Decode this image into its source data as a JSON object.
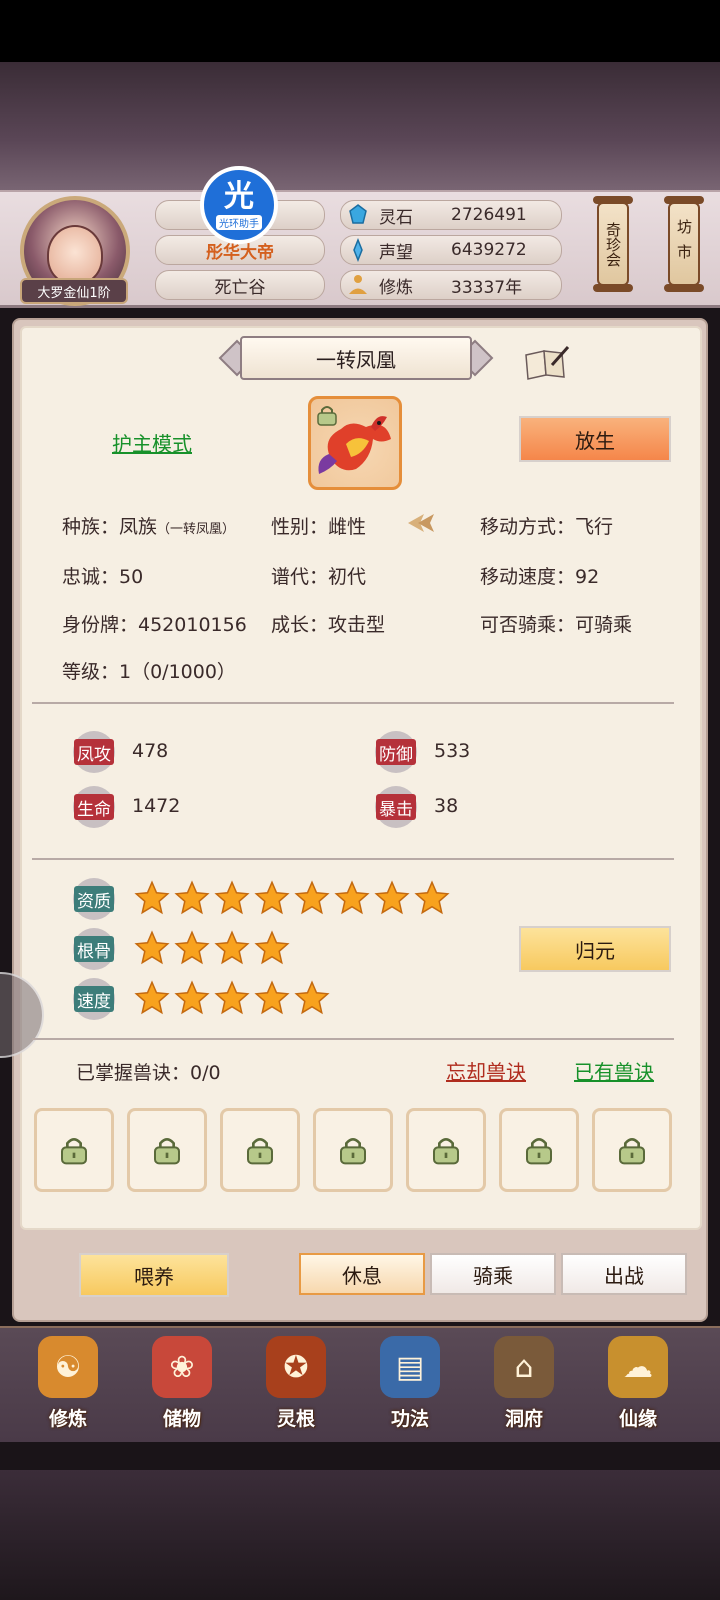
{
  "player": {
    "rank": "大罗金仙1阶",
    "title": "彤华大帝",
    "location": "死亡谷"
  },
  "overlay_badge": {
    "glyph": "光",
    "text": "光环助手"
  },
  "resources": [
    {
      "icon": "spirit-stone-icon",
      "label": "灵石",
      "value": "2726491"
    },
    {
      "icon": "reputation-icon",
      "label": "声望",
      "value": "6439272"
    },
    {
      "icon": "meditation-icon",
      "label": "修炼",
      "value": "33337年"
    }
  ],
  "side_buttons": {
    "treasure": "奇珍会",
    "market": "坊市"
  },
  "pet": {
    "name": "一转凤凰",
    "guard_mode": "护主模式",
    "release": "放生",
    "info_rows": [
      [
        {
          "text": "种族：凤族",
          "sub": "（一转凤凰）"
        },
        {
          "text": "性别：雌性"
        },
        {
          "text": "移动方式：飞行"
        }
      ],
      [
        {
          "text": "忠诚：50"
        },
        {
          "text": "谱代：初代"
        },
        {
          "text": "移动速度：92"
        }
      ],
      [
        {
          "text": "身份牌：452010156"
        },
        {
          "text": "成长：攻击型"
        },
        {
          "text": "可否骑乘：可骑乘"
        }
      ],
      [
        {
          "text": "等级：1（0/1000）"
        }
      ]
    ],
    "stats": [
      {
        "label": "凤攻",
        "value": "478"
      },
      {
        "label": "防御",
        "value": "533"
      },
      {
        "label": "生命",
        "value": "1472"
      },
      {
        "label": "暴击",
        "value": "38"
      }
    ],
    "ratings": [
      {
        "label": "资质",
        "stars": 8
      },
      {
        "label": "根骨",
        "stars": 4
      },
      {
        "label": "速度",
        "stars": 5
      }
    ],
    "return_origin": "归元",
    "skills_mastered": "已掌握兽诀：0/0",
    "forget_skill": "忘却兽诀",
    "owned_skills": "已有兽诀",
    "skill_slots": 7
  },
  "actions": {
    "feed": "喂养",
    "rest": "休息",
    "ride": "骑乘",
    "battle": "出战"
  },
  "nav": [
    {
      "label": "修炼",
      "icon": "cultivate-icon",
      "color": "#d88a2e"
    },
    {
      "label": "储物",
      "icon": "storage-bag-icon",
      "color": "#c8483a"
    },
    {
      "label": "灵根",
      "icon": "spirit-root-icon",
      "color": "#a8401c"
    },
    {
      "label": "功法",
      "icon": "skill-book-icon",
      "color": "#3a6aa8"
    },
    {
      "label": "洞府",
      "icon": "cave-mansion-icon",
      "color": "#7a5a3a"
    },
    {
      "label": "仙缘",
      "icon": "immortal-fate-icon",
      "color": "#c8902e"
    }
  ]
}
